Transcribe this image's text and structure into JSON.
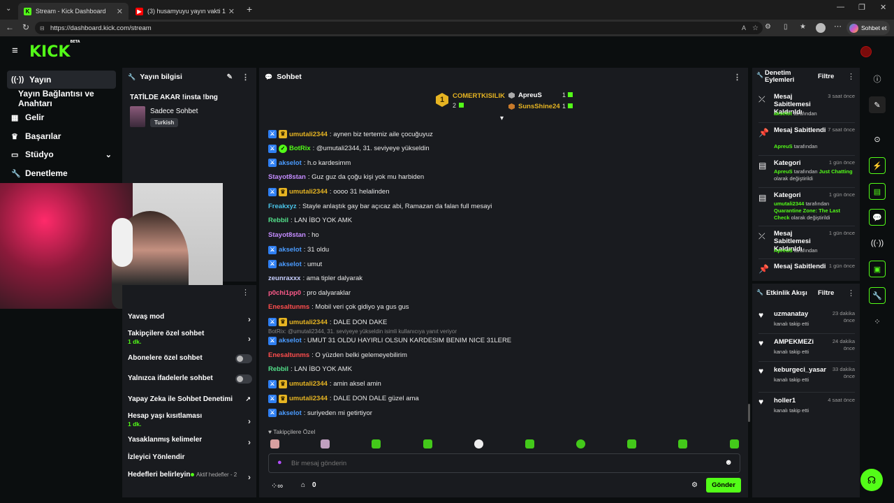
{
  "browser": {
    "tabs": [
      {
        "title": "Stream - Kick Dashboard",
        "active": true
      },
      {
        "title": "(3) husamyuyu yayın vakti 14 - Yo"
      }
    ],
    "url": "https://dashboard.kick.com/stream",
    "profile_label": "Sohbet et"
  },
  "app": {
    "logo": "KICK",
    "logo_sup": "BETA"
  },
  "sidebar": {
    "items": [
      {
        "label": "Yayın",
        "icon": "broadcast-icon",
        "active": true
      },
      {
        "label": "Yayın Bağlantısı ve Anahtarı"
      },
      {
        "label": "Gelir",
        "icon": "bank-icon"
      },
      {
        "label": "Başarılar",
        "icon": "trophy-icon"
      },
      {
        "label": "Stüdyo",
        "icon": "studio-icon"
      },
      {
        "label": "Denetleme",
        "icon": "wrench-icon"
      }
    ]
  },
  "stream_info": {
    "header": "Yayın bilgisi",
    "title": "TATİLDE AKAR !insta !bng",
    "category": "Sadece Sohbet",
    "tag": "Turkish"
  },
  "chat": {
    "header": "Sohbet",
    "leaderboard": [
      {
        "rank": "1",
        "name": "COMERTKISILIK",
        "count": "2"
      },
      {
        "name": "ApreuS",
        "count": "1"
      },
      {
        "name": "SunsShine24",
        "count": "1"
      }
    ],
    "messages": [
      {
        "user": "umutali2344",
        "text": ": aynen biz tertemiz aile çocuğuyuz",
        "color": "#e6b422",
        "badges": [
          "blue",
          "gold"
        ]
      },
      {
        "user": "BotRix",
        "text": ": @umutali2344, 31. seviyeye yükseldin",
        "color": "#53fc18",
        "badges": [
          "blue",
          "green"
        ]
      },
      {
        "user": "akselot",
        "text": ": h.o kardesimm",
        "color": "#4a9bff",
        "badges": [
          "blue"
        ]
      },
      {
        "user": "Stayot8stan",
        "text": ": Guz guz da çoğu kişi yok mu harbiden",
        "color": "#c48cff",
        "badges": []
      },
      {
        "user": "umutali2344",
        "text": ": oooo 31 helalinden",
        "color": "#e6b422",
        "badges": [
          "blue",
          "gold"
        ]
      },
      {
        "user": "Freakxyz",
        "text": ": Stayle anlaştık gay bar açıcaz abi, Ramazan da falan full mesayi",
        "color": "#4ac4e8",
        "badges": []
      },
      {
        "user": "Rebbil",
        "text": ": LAN İBO YOK AMK",
        "color": "#53e08a",
        "badges": []
      },
      {
        "user": "Stayot8stan",
        "text": ": ho",
        "color": "#c48cff",
        "badges": []
      },
      {
        "user": "akselot",
        "text": ": 31 oldu",
        "color": "#4a9bff",
        "badges": [
          "blue"
        ]
      },
      {
        "user": "akselot",
        "text": ": umut",
        "color": "#4a9bff",
        "badges": [
          "blue"
        ]
      },
      {
        "user": "zeunraxxx",
        "text": ": ama tipler dalyarak",
        "color": "#c8d0ff",
        "badges": []
      },
      {
        "user": "p0chi1pp0",
        "text": ": pro dalyaraklar",
        "color": "#ff5a8a",
        "badges": []
      },
      {
        "user": "Enesaltunms",
        "text": ": Mobil veri çok gidiyo ya gus gus",
        "color": "#ff4d4d",
        "badges": []
      },
      {
        "user": "umutali2344",
        "text": ": DALE DON DAKE",
        "color": "#e6b422",
        "badges": [
          "blue",
          "gold"
        ]
      },
      {
        "user": "akselot",
        "text": ": UMUT 31 OLDU HAYIRLI OLSUN KARDESIM BENIM NICE 31LERE",
        "color": "#4a9bff",
        "badges": [
          "blue"
        ],
        "reply": "BotRix: @umutali2344, 31. seviyeye yükseldin isimli kullanıcıya yanıt veriyor"
      },
      {
        "user": "Enesaltunms",
        "text": ": O yüzden belki gelemeyebilirim",
        "color": "#ff4d4d",
        "badges": []
      },
      {
        "user": "Rebbil",
        "text": ": LAN İBO YOK AMK",
        "color": "#53e08a",
        "badges": []
      },
      {
        "user": "umutali2344",
        "text": ": amin aksel amin",
        "color": "#e6b422",
        "badges": [
          "blue",
          "gold"
        ]
      },
      {
        "user": "umutali2344",
        "text": ": DALE DON DALE güzel ama",
        "color": "#e6b422",
        "badges": [
          "blue",
          "gold"
        ]
      },
      {
        "user": "akselot",
        "text": ": suriyeden mi getirtiyor",
        "color": "#4a9bff",
        "badges": [
          "blue"
        ]
      }
    ],
    "followers_only": "Takipçilere Özel",
    "input_placeholder": "Bir mesaj gönderin",
    "points": "0",
    "send": "Gönder"
  },
  "mod_settings": [
    {
      "label": "Yavaş mod",
      "type": "chevron"
    },
    {
      "label": "Takipçilere özel sohbet",
      "sub": "1 dk.",
      "type": "chevron"
    },
    {
      "label": "Abonelere özel sohbet",
      "type": "toggle"
    },
    {
      "label": "Yalnızca ifadelerle sohbet",
      "type": "toggle"
    },
    {
      "label": "Yapay Zeka ile Sohbet Denetimi",
      "type": "external"
    },
    {
      "label": "Hesap yaşı kısıtlaması",
      "sub": "1 dk.",
      "type": "chevron"
    },
    {
      "label": "Yasaklanmış kelimeler",
      "type": "chevron"
    },
    {
      "label": "İzleyici Yönlendir",
      "type": "none"
    },
    {
      "label": "Hedefleri belirleyin",
      "extra": "Aktif hedefler - 2",
      "type": "chevron"
    }
  ],
  "mod_actions": {
    "header": "Denetim Eylemleri",
    "filter": "Filtre",
    "items": [
      {
        "title": "Mesaj Sabitlemesi Kaldırıldı",
        "time": "3 saat önce",
        "by_user": "akselot",
        "by_rest": " tarafından",
        "icon": "unpin-icon"
      },
      {
        "title": "Mesaj Sabitlendi",
        "time": "7 saat önce",
        "by_user": "ApreuS",
        "by_rest": " tarafından",
        "icon": "pin-icon"
      },
      {
        "title": "Kategori",
        "time": "1 gün önce",
        "by_user": "ApreuS",
        "by_rest": " tarafından ",
        "by_green": "Just Chatting",
        "by_end": " olarak değiştirildi",
        "icon": "category-icon"
      },
      {
        "title": "Kategori",
        "time": "1 gün önce",
        "by_user": "umutali2344",
        "by_rest": " tarafından ",
        "by_green": "Quarantine Zone: The Last Check",
        "by_end": " olarak değiştirildi",
        "icon": "category-icon"
      },
      {
        "title": "Mesaj Sabitlemesi Kaldırıldı",
        "time": "1 gün önce",
        "by_user": "ApreuS",
        "by_rest": " tarafından",
        "icon": "unpin-icon"
      },
      {
        "title": "Mesaj Sabitlendi",
        "time": "1 gün önce",
        "icon": "pin-icon"
      }
    ]
  },
  "activity": {
    "header": "Etkinlik Akışı",
    "filter": "Filtre",
    "items": [
      {
        "user": "uzmanatay",
        "time": "23 dakika önce",
        "action": "kanalı takip etti"
      },
      {
        "user": "AMPEKMEZi",
        "time": "24 dakika önce",
        "action": "kanalı takip etti"
      },
      {
        "user": "keburgeci_yasar",
        "time": "33 dakika önce",
        "action": "kanalı takip etti"
      },
      {
        "user": "holler1",
        "time": "4 saat önce",
        "action": "kanalı takip etti"
      }
    ]
  },
  "colors": {
    "accent": "#53fc18",
    "panel": "#191b1f",
    "bg": "#0b0e0f"
  }
}
